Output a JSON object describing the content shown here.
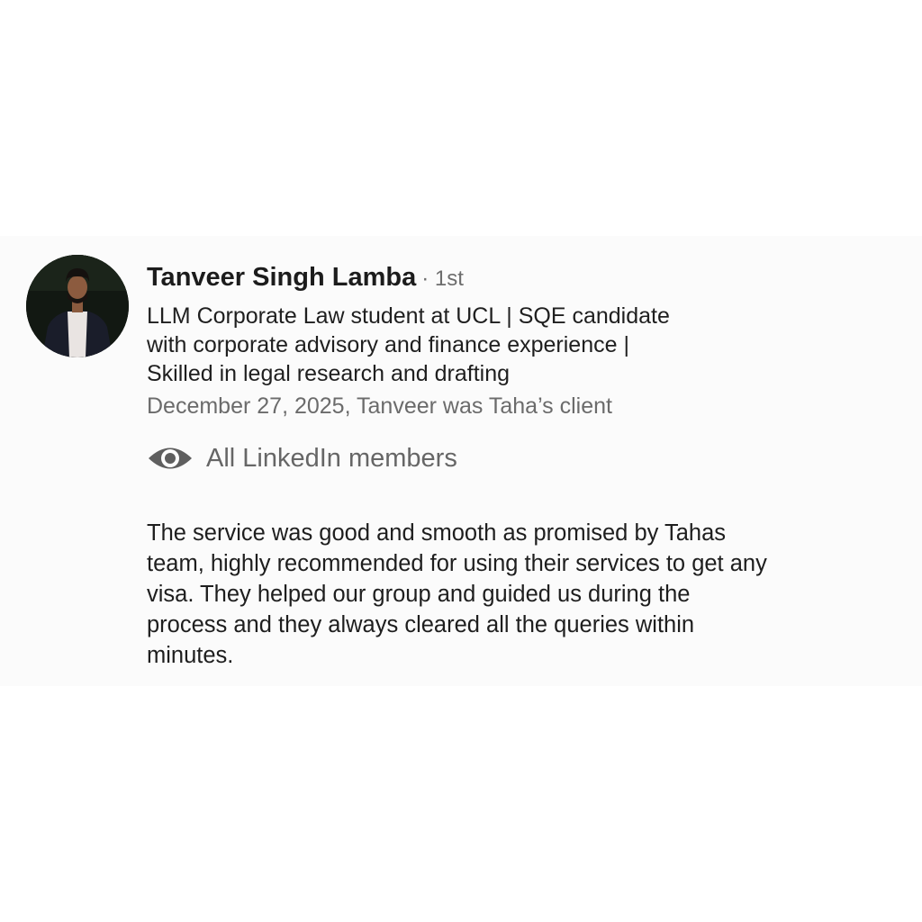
{
  "recommendation": {
    "author_name": "Tanveer Singh Lamba",
    "connection_degree": "· 1st",
    "headline_lines": [
      "LLM Corporate Law student at UCL | SQE candidate",
      "with corporate advisory and finance experience |",
      "Skilled in legal research and drafting"
    ],
    "date_relationship": "December 27, 2025, Tanveer was Taha’s client",
    "visibility": {
      "icon": "eye-icon",
      "label": "All LinkedIn members"
    },
    "body_lines": [
      "The service was good and smooth as promised by Tahas",
      "team, highly recommended for using their services to get any",
      "visa. They helped our group and guided us during the",
      "process and they always cleared all the queries within",
      "minutes."
    ]
  },
  "colors": {
    "name_text": "#1c1c1c",
    "secondary_text": "#6b6b6b",
    "body_text": "#1e1e1e",
    "card_background": "#fbfbfb",
    "page_background": "#ffffff"
  }
}
